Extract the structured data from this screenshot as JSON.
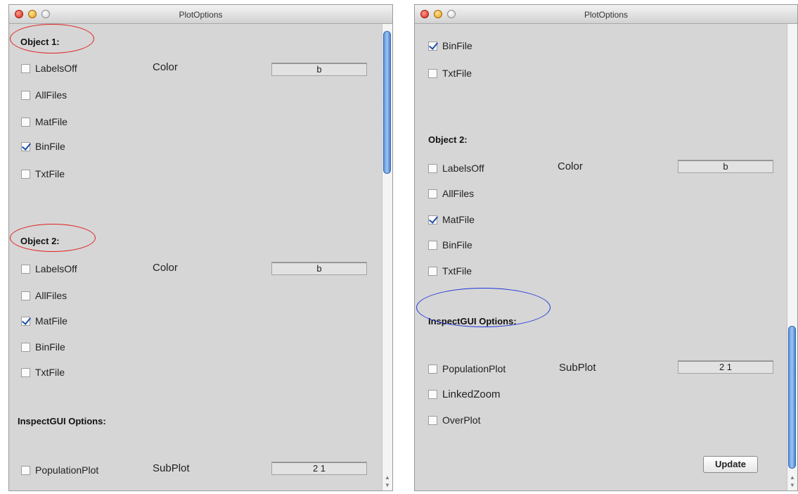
{
  "left_window": {
    "title": "PlotOptions",
    "object1": {
      "heading": "Object 1:",
      "color_label": "Color",
      "color_value": "b",
      "checkboxes": [
        {
          "label": "LabelsOff",
          "checked": false
        },
        {
          "label": "AllFiles",
          "checked": false
        },
        {
          "label": "MatFile",
          "checked": false
        },
        {
          "label": "BinFile",
          "checked": true
        },
        {
          "label": "TxtFile",
          "checked": false
        }
      ]
    },
    "object2": {
      "heading": "Object 2:",
      "color_label": "Color",
      "color_value": "b",
      "checkboxes": [
        {
          "label": "LabelsOff",
          "checked": false
        },
        {
          "label": "AllFiles",
          "checked": false
        },
        {
          "label": "MatFile",
          "checked": true
        },
        {
          "label": "BinFile",
          "checked": false
        },
        {
          "label": "TxtFile",
          "checked": false
        }
      ]
    },
    "inspect": {
      "heading": "InspectGUI Options:",
      "population_plot": {
        "label": "PopulationPlot",
        "checked": false
      },
      "subplot_label": "SubPlot",
      "subplot_value": "2 1"
    },
    "scroll_position": 0
  },
  "right_window": {
    "title": "PlotOptions",
    "object1_tail": [
      {
        "label": "BinFile",
        "checked": true
      },
      {
        "label": "TxtFile",
        "checked": false
      }
    ],
    "object2": {
      "heading": "Object 2:",
      "color_label": "Color",
      "color_value": "b",
      "checkboxes": [
        {
          "label": "LabelsOff",
          "checked": false
        },
        {
          "label": "AllFiles",
          "checked": false
        },
        {
          "label": "MatFile",
          "checked": true
        },
        {
          "label": "BinFile",
          "checked": false
        },
        {
          "label": "TxtFile",
          "checked": false
        }
      ]
    },
    "inspect": {
      "heading": "InspectGUI Options:",
      "checkboxes": [
        {
          "label": "PopulationPlot",
          "checked": false
        },
        {
          "label": "LinkedZoom",
          "checked": false
        },
        {
          "label": "OverPlot",
          "checked": false
        }
      ],
      "subplot_label": "SubPlot",
      "subplot_value": "2 1"
    },
    "update_button": "Update",
    "scroll_position": 1
  },
  "colors": {
    "window_bg": "#d6d6d6",
    "highlight_red": "#e02020",
    "highlight_blue": "#1f35d8",
    "check_blue": "#1d4fa8"
  }
}
